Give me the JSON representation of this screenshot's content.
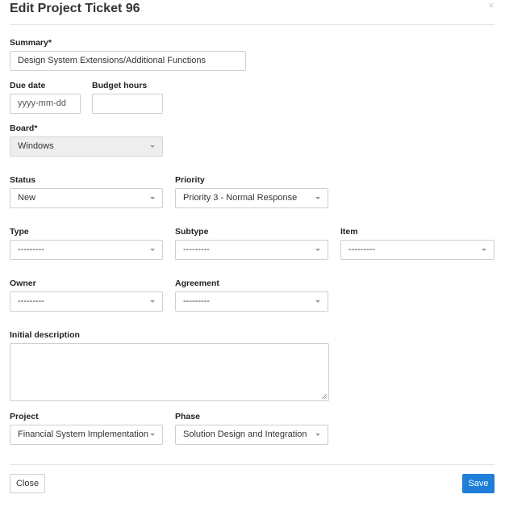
{
  "dialog": {
    "title": "Edit Project Ticket 96",
    "close_glyph": "×"
  },
  "fields": {
    "summary": {
      "label": "Summary*",
      "value": "Design System Extensions/Additional Functions"
    },
    "due_date": {
      "label": "Due date",
      "placeholder": "yyyy-mm-dd"
    },
    "budget_hours": {
      "label": "Budget hours",
      "value": ""
    },
    "board": {
      "label": "Board*",
      "value": "Windows"
    },
    "status": {
      "label": "Status",
      "value": "New"
    },
    "priority": {
      "label": "Priority",
      "value": "Priority 3 - Normal Response"
    },
    "type": {
      "label": "Type",
      "value": "---------"
    },
    "subtype": {
      "label": "Subtype",
      "value": "---------"
    },
    "item": {
      "label": "Item",
      "value": "---------"
    },
    "owner": {
      "label": "Owner",
      "value": "---------"
    },
    "agreement": {
      "label": "Agreement",
      "value": "---------"
    },
    "initial_description": {
      "label": "Initial description",
      "value": ""
    },
    "project": {
      "label": "Project",
      "value": "Financial System Implementation"
    },
    "phase": {
      "label": "Phase",
      "value": "Solution Design and Integration"
    }
  },
  "footer": {
    "close_label": "Close",
    "save_label": "Save"
  },
  "colors": {
    "primary": "#1e7ed9",
    "border": "#cfcfcf",
    "disabled_bg": "#eeeeee"
  }
}
